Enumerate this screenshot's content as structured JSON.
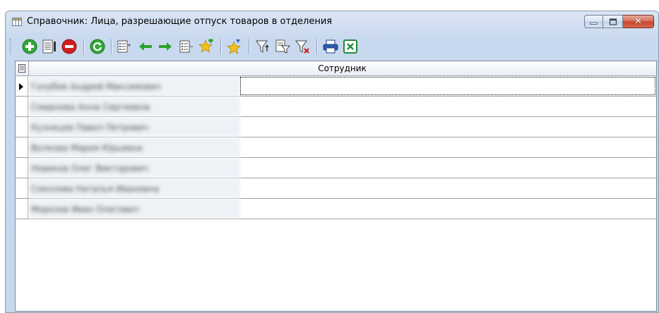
{
  "window": {
    "title": "Справочник: Лица, разрешающие отпуск товаров в отделения",
    "controls": {
      "minimize": "minimize",
      "maximize": "maximize",
      "close": "✕"
    }
  },
  "toolbar": {
    "icons": [
      "add-icon",
      "edit-icon",
      "delete-icon",
      "refresh-icon",
      "expand-icon",
      "arrow-left-icon",
      "arrow-right-icon",
      "collapse-icon",
      "star-add-icon",
      "star-down-icon",
      "filter-icon",
      "filter-edit-icon",
      "filter-clear-icon",
      "print-icon",
      "excel-export-icon"
    ]
  },
  "grid": {
    "column_header": "Сотрудник",
    "rows": [
      {
        "name": "Голубев Андрей Максимович"
      },
      {
        "name": "Смирнова Анна Сергеевна"
      },
      {
        "name": "Кузнецов Павел Петрович"
      },
      {
        "name": "Волкова Мария Юрьевна"
      },
      {
        "name": "Новиков Олег Викторович"
      },
      {
        "name": "Соколова Наталья Ивановна"
      },
      {
        "name": "Морозов Иван Олегович"
      }
    ]
  },
  "colors": {
    "title_gradient": "#c8d8ee",
    "close_button": "#c5432a",
    "add_green": "#35a539",
    "delete_red": "#d01f1f",
    "arrow_green": "#2aa22a"
  }
}
